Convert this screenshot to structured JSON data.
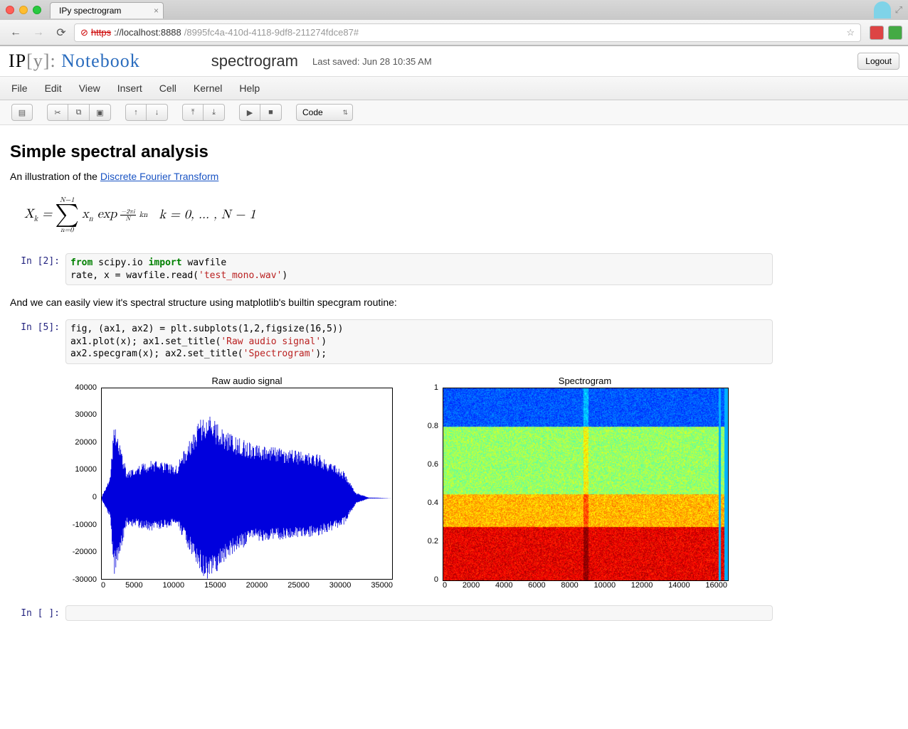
{
  "browser": {
    "tab_title": "IPy spectrogram",
    "url_scheme": "https",
    "url_hostport": "://localhost:8888",
    "url_path": "/8995fc4a-410d-4118-9df8-211274fdce87#"
  },
  "header": {
    "logo_ip": "IP",
    "logo_y": "[y]:",
    "logo_nb": "Notebook",
    "title": "spectrogram",
    "last_saved": "Last saved: Jun 28 10:35 AM",
    "logout": "Logout"
  },
  "menu": [
    "File",
    "Edit",
    "View",
    "Insert",
    "Cell",
    "Kernel",
    "Help"
  ],
  "toolbar": {
    "icons": [
      "save",
      "cut",
      "copy",
      "paste",
      "up",
      "down",
      "run-above",
      "run-below",
      "run",
      "stop"
    ],
    "glyphs": [
      "▤",
      "✂",
      "⧉",
      "▣",
      "↑",
      "↓",
      "⤒",
      "⤓",
      "▶",
      "■"
    ],
    "cell_type": "Code"
  },
  "content": {
    "h1": "Simple spectral analysis",
    "intro_prefix": "An illustration of the ",
    "intro_link": "Discrete Fourier Transform",
    "math_range": "k = 0, … , N − 1",
    "cell2_prompt": "In [2]:",
    "cell2_code_tokens": [
      {
        "t": "from ",
        "c": "kw"
      },
      {
        "t": "scipy.io ",
        "c": ""
      },
      {
        "t": "import ",
        "c": "kw"
      },
      {
        "t": "wavfile\n",
        "c": ""
      },
      {
        "t": "rate, x = wavfile.read(",
        "c": ""
      },
      {
        "t": "'test_mono.wav'",
        "c": "str"
      },
      {
        "t": ")",
        "c": ""
      }
    ],
    "mid_text": "And we can easily view it's spectral structure using matplotlib's builtin specgram routine:",
    "cell5_prompt": "In [5]:",
    "cell5_code_tokens": [
      {
        "t": "fig, (ax1, ax2) = plt.subplots(1,2,figsize(16,5))\n",
        "c": ""
      },
      {
        "t": "ax1.plot(x); ax1.set_title(",
        "c": ""
      },
      {
        "t": "'Raw audio signal'",
        "c": "str"
      },
      {
        "t": ")\n",
        "c": ""
      },
      {
        "t": "ax2.specgram(x); ax2.set_title(",
        "c": ""
      },
      {
        "t": "'Spectrogram'",
        "c": "str"
      },
      {
        "t": ");",
        "c": ""
      }
    ],
    "empty_prompt": "In [ ]:"
  },
  "chart_data": [
    {
      "type": "line",
      "title": "Raw audio signal",
      "xlim": [
        0,
        35000
      ],
      "ylim": [
        -30000,
        40000
      ],
      "x_ticks": [
        0,
        5000,
        10000,
        15000,
        20000,
        25000,
        30000,
        35000
      ],
      "y_ticks": [
        -30000,
        -20000,
        -10000,
        0,
        10000,
        20000,
        30000,
        40000
      ],
      "description": "Dense oscillatory audio waveform, amplitude roughly ±10000 early, bursting to ±30000 around x≈12000-18000, sustained ±15000 until x≈30000, then near zero.",
      "envelope_samples": [
        {
          "x": 0,
          "min": -500,
          "max": 500
        },
        {
          "x": 1000,
          "min": -8000,
          "max": 8000
        },
        {
          "x": 1500,
          "min": -28000,
          "max": 27000
        },
        {
          "x": 3000,
          "min": -10000,
          "max": 10000
        },
        {
          "x": 6000,
          "min": -12000,
          "max": 14000
        },
        {
          "x": 9000,
          "min": -10000,
          "max": 12000
        },
        {
          "x": 12000,
          "min": -28000,
          "max": 30000
        },
        {
          "x": 13000,
          "min": -30000,
          "max": 30000
        },
        {
          "x": 15000,
          "min": -22000,
          "max": 24000
        },
        {
          "x": 18000,
          "min": -16000,
          "max": 20000
        },
        {
          "x": 22000,
          "min": -15000,
          "max": 18000
        },
        {
          "x": 26000,
          "min": -14000,
          "max": 16000
        },
        {
          "x": 29000,
          "min": -10000,
          "max": 10000
        },
        {
          "x": 30500,
          "min": -2000,
          "max": 2000
        },
        {
          "x": 32000,
          "min": -200,
          "max": 200
        },
        {
          "x": 35000,
          "min": 0,
          "max": 0
        }
      ]
    },
    {
      "type": "heatmap",
      "title": "Spectrogram",
      "xlim": [
        0,
        16000
      ],
      "ylim": [
        0.0,
        1.0
      ],
      "x_ticks": [
        0,
        2000,
        4000,
        6000,
        8000,
        10000,
        12000,
        14000,
        16000
      ],
      "y_ticks": [
        0.0,
        0.2,
        0.4,
        0.6,
        0.8,
        1.0
      ],
      "description": "Jet-colormap spectrogram: high energy (red) concentrated at low frequencies y<0.3 across all time; mid band 0.3-0.8 yellow/green; top band >0.8 cyan/blue; vertical streaks near x≈8000 and x≈15500."
    }
  ]
}
